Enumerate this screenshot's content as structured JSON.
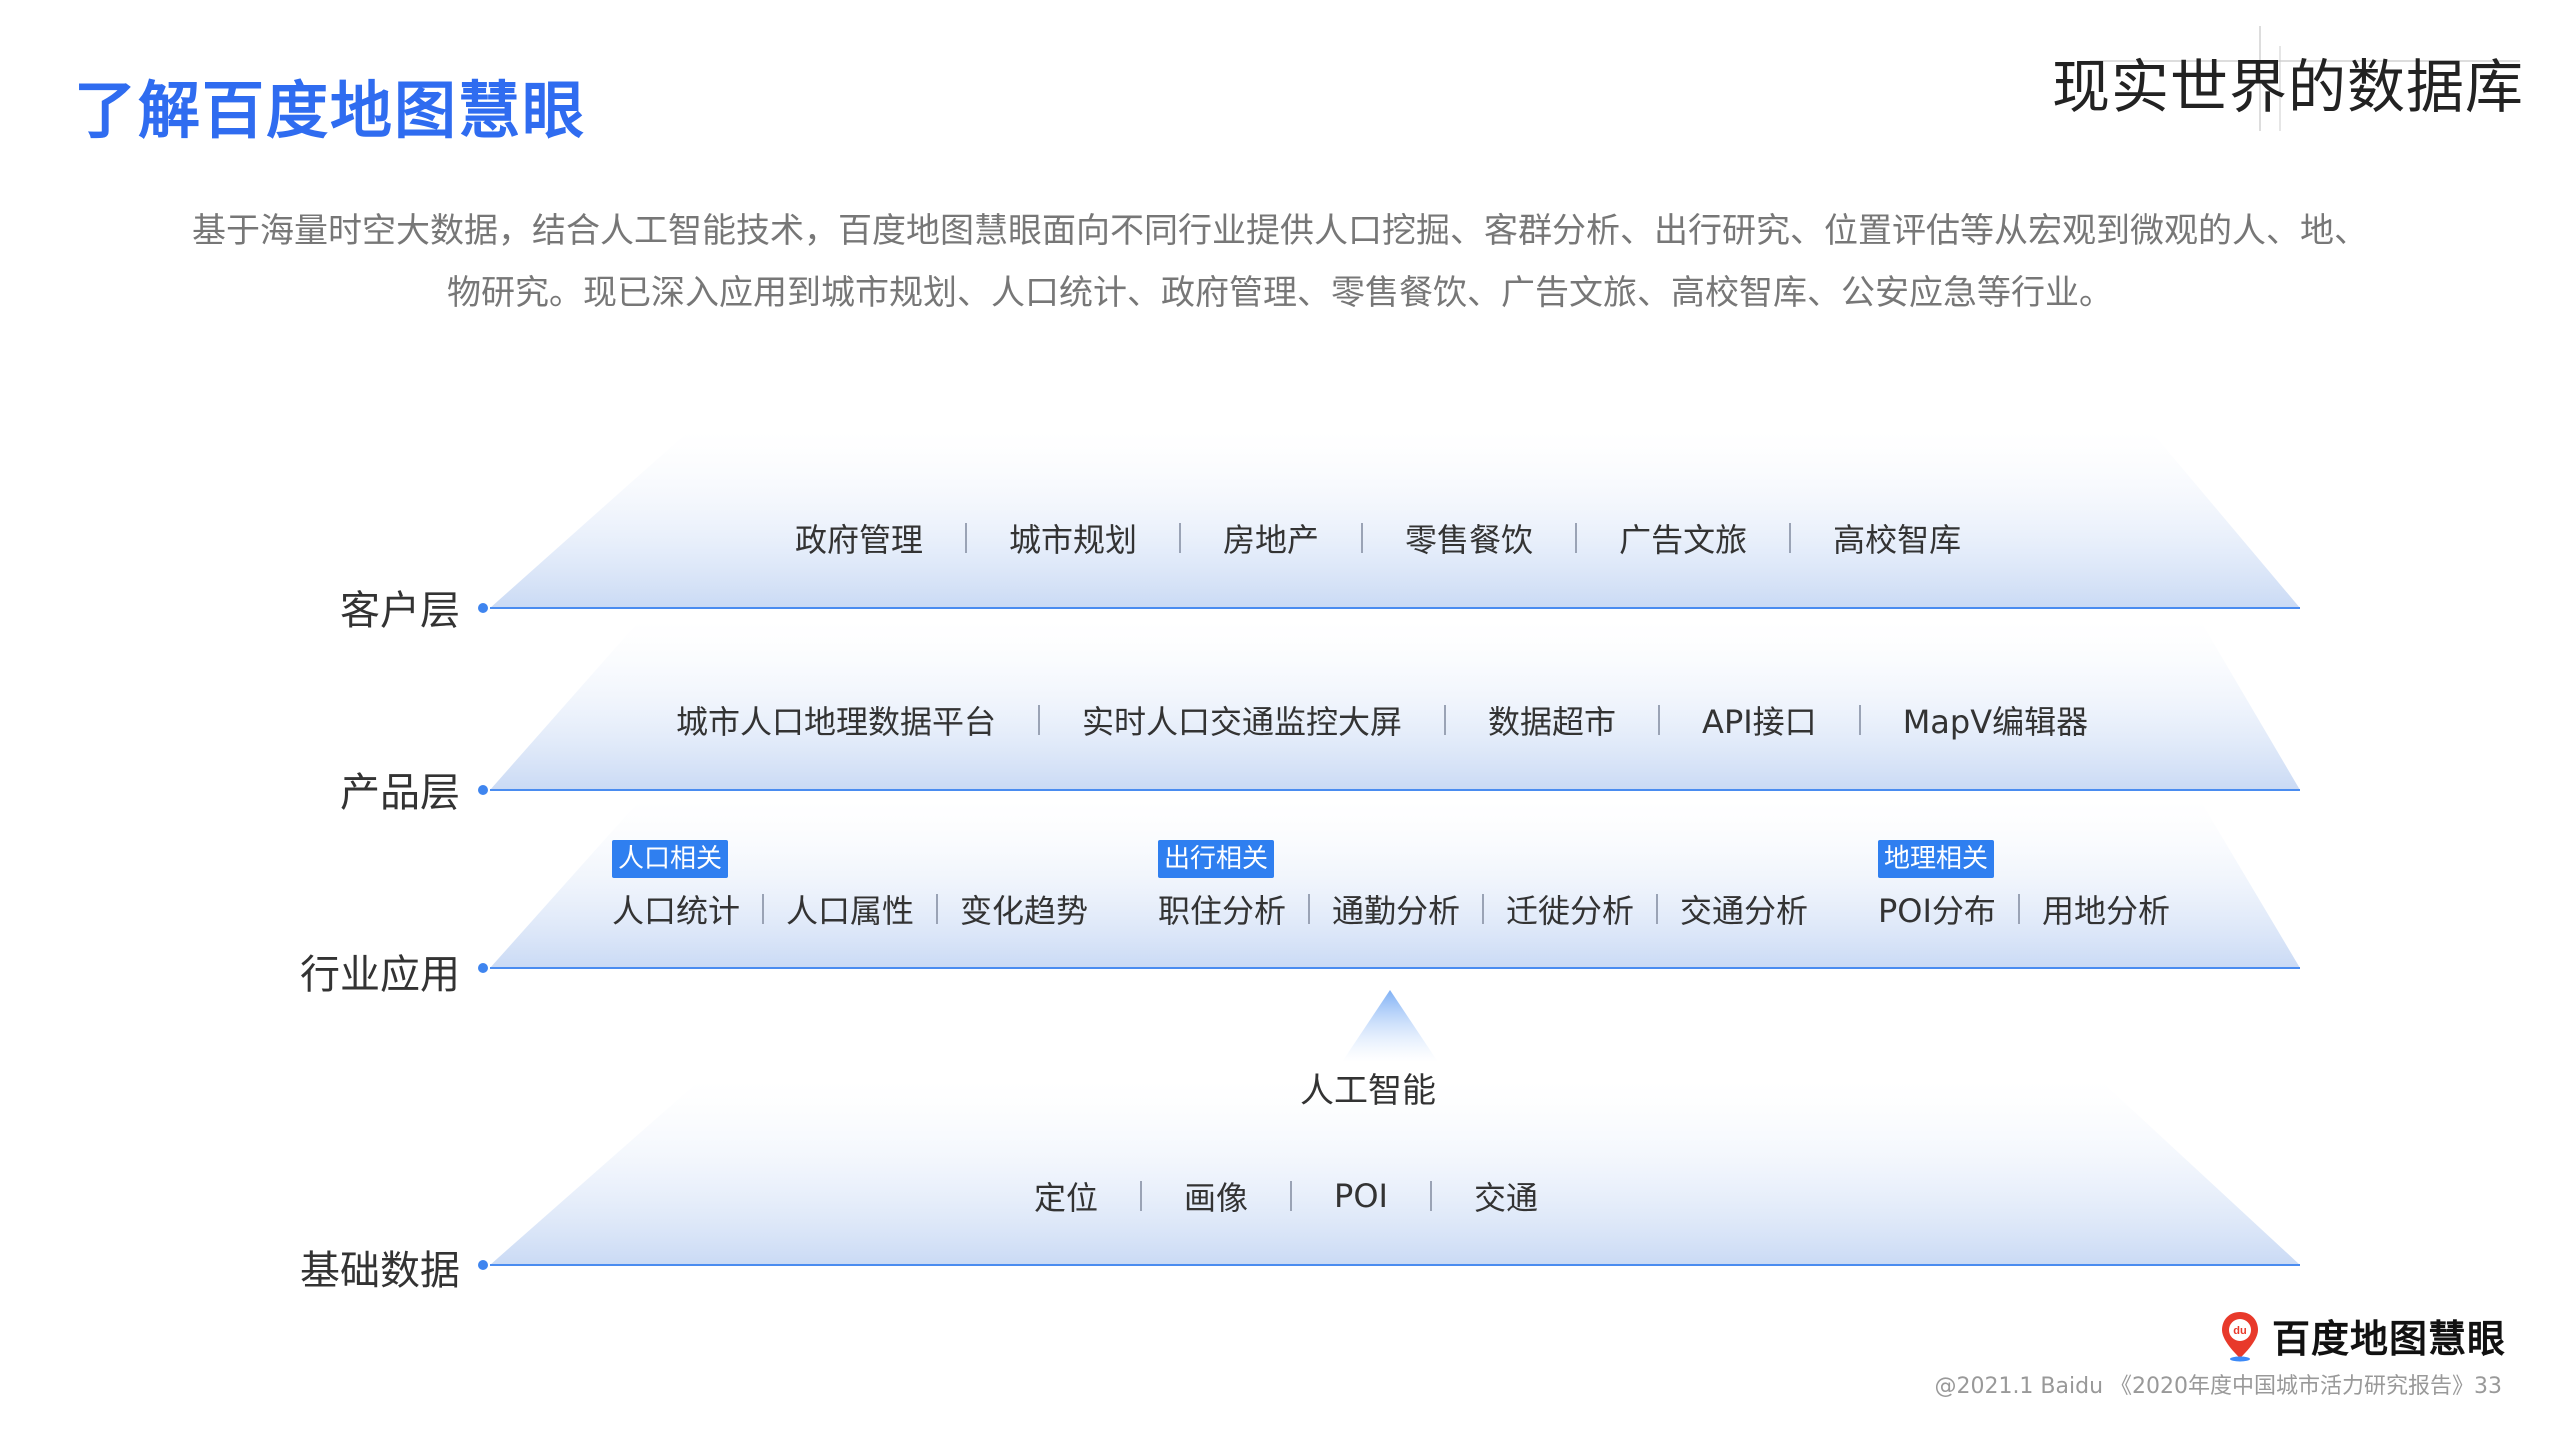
{
  "header": {
    "title": "了解百度地图慧眼",
    "tagline": "现实世界的数据库"
  },
  "intro": {
    "line1": "基于海量时空大数据，结合人工智能技术，百度地图慧眼面向不同行业提供人口挖掘、客群分析、出行研究、位置评估等从宏观到微观的人、地、",
    "line2": "物研究。现已深入应用到城市规划、人口统计、政府管理、零售餐饮、广告文旅、高校智库、公安应急等行业。"
  },
  "layers": {
    "customer": {
      "label": "客户层",
      "items": [
        "政府管理",
        "城市规划",
        "房地产",
        "零售餐饮",
        "广告文旅",
        "高校智库"
      ]
    },
    "product": {
      "label": "产品层",
      "items": [
        "城市人口地理数据平台",
        "实时人口交通监控大屏",
        "数据超市",
        "API接口",
        "MapV编辑器"
      ]
    },
    "industry": {
      "label": "行业应用",
      "groups": [
        {
          "badge": "人口相关",
          "items": [
            "人口统计",
            "人口属性",
            "变化趋势"
          ]
        },
        {
          "badge": "出行相关",
          "items": [
            "职住分析",
            "通勤分析",
            "迁徙分析",
            "交通分析"
          ]
        },
        {
          "badge": "地理相关",
          "items": [
            "POI分布",
            "用地分析"
          ]
        }
      ]
    },
    "ai": {
      "label": "人工智能"
    },
    "base": {
      "label": "基础数据",
      "items": [
        "定位",
        "画像",
        "POI",
        "交通"
      ]
    }
  },
  "brand": {
    "name": "百度地图慧眼",
    "logo_text": "du"
  },
  "footer": {
    "text": "@2021.1 Baidu 《2020年度中国城市活力研究报告》33"
  }
}
